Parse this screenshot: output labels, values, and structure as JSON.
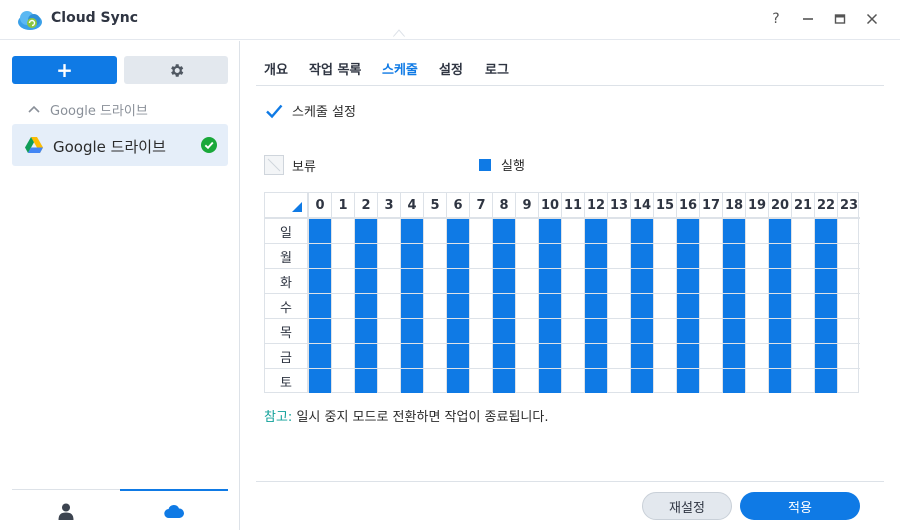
{
  "window": {
    "title": "Cloud Sync",
    "controls": {
      "help": "?",
      "minimize": "—",
      "maximize": "□",
      "close": "✕"
    }
  },
  "sidebar": {
    "add_label": "+",
    "group_label": "Google 드라이브",
    "connections": [
      {
        "label": "Google 드라이브",
        "status": "ok"
      }
    ],
    "bottom_tabs": [
      {
        "icon": "user-icon",
        "active": false
      },
      {
        "icon": "cloud-icon",
        "active": true
      }
    ]
  },
  "tabs": [
    {
      "label": "개요",
      "active": false
    },
    {
      "label": "작업 목록",
      "active": false
    },
    {
      "label": "스케줄",
      "active": true
    },
    {
      "label": "설정",
      "active": false
    },
    {
      "label": "로그",
      "active": false
    }
  ],
  "schedule": {
    "enable_label": "스케줄 설정",
    "enabled": true,
    "legend": {
      "pause_label": "보류",
      "run_label": "실행"
    },
    "hours": [
      "0",
      "1",
      "2",
      "3",
      "4",
      "5",
      "6",
      "7",
      "8",
      "9",
      "10",
      "11",
      "12",
      "13",
      "14",
      "15",
      "16",
      "17",
      "18",
      "19",
      "20",
      "21",
      "22",
      "23"
    ],
    "days": [
      "일",
      "월",
      "화",
      "수",
      "목",
      "금",
      "토"
    ],
    "run_hours": [
      0,
      2,
      4,
      6,
      8,
      10,
      12,
      14,
      16,
      18,
      20,
      22
    ]
  },
  "note": {
    "prefix": "참고:",
    "text": " 일시 중지 모드로 전환하면 작업이 종료됩니다."
  },
  "footer": {
    "reset_label": "재설정",
    "apply_label": "적용"
  },
  "colors": {
    "accent": "#0f7ae5",
    "success": "#1aa83a",
    "note_prefix": "#12a19a"
  }
}
